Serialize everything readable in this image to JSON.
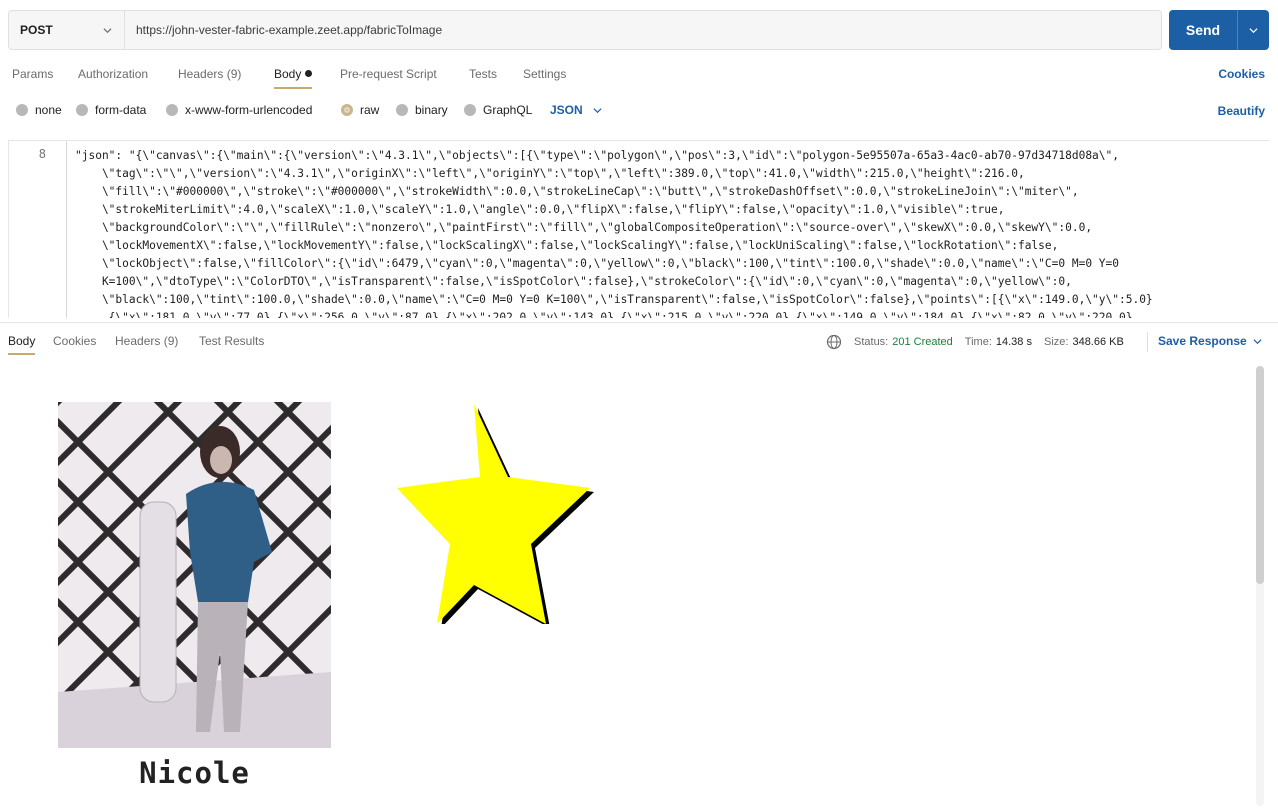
{
  "request": {
    "method": "POST",
    "url": "https://john-vester-fabric-example.zeet.app/fabricToImage",
    "send_label": "Send"
  },
  "request_tabs": [
    {
      "label": "Params"
    },
    {
      "label": "Authorization"
    },
    {
      "label": "Headers",
      "count": "(9)"
    },
    {
      "label": "Body"
    },
    {
      "label": "Pre-request Script"
    },
    {
      "label": "Tests"
    },
    {
      "label": "Settings"
    }
  ],
  "cookies_label": "Cookies",
  "body_types": [
    {
      "label": "none"
    },
    {
      "label": "form-data"
    },
    {
      "label": "x-www-form-urlencoded"
    },
    {
      "label": "raw"
    },
    {
      "label": "binary"
    },
    {
      "label": "GraphQL"
    }
  ],
  "body_format": "JSON",
  "beautify_label": "Beautify",
  "editor": {
    "line_number": "8",
    "lines": [
      "\"json\": \"{\\\"canvas\\\":{\\\"main\\\":{\\\"version\\\":\\\"4.3.1\\\",\\\"objects\\\":[{\\\"type\\\":\\\"polygon\\\",\\\"pos\\\":3,\\\"id\\\":\\\"polygon-5e95507a-65a3-4ac0-ab70-97d34718d08a\\\",",
      "    \\\"tag\\\":\\\"\\\",\\\"version\\\":\\\"4.3.1\\\",\\\"originX\\\":\\\"left\\\",\\\"originY\\\":\\\"top\\\",\\\"left\\\":389.0,\\\"top\\\":41.0,\\\"width\\\":215.0,\\\"height\\\":216.0,",
      "    \\\"fill\\\":\\\"#000000\\\",\\\"stroke\\\":\\\"#000000\\\",\\\"strokeWidth\\\":0.0,\\\"strokeLineCap\\\":\\\"butt\\\",\\\"strokeDashOffset\\\":0.0,\\\"strokeLineJoin\\\":\\\"miter\\\",",
      "    \\\"strokeMiterLimit\\\":4.0,\\\"scaleX\\\":1.0,\\\"scaleY\\\":1.0,\\\"angle\\\":0.0,\\\"flipX\\\":false,\\\"flipY\\\":false,\\\"opacity\\\":1.0,\\\"visible\\\":true,",
      "    \\\"backgroundColor\\\":\\\"\\\",\\\"fillRule\\\":\\\"nonzero\\\",\\\"paintFirst\\\":\\\"fill\\\",\\\"globalCompositeOperation\\\":\\\"source-over\\\",\\\"skewX\\\":0.0,\\\"skewY\\\":0.0,",
      "    \\\"lockMovementX\\\":false,\\\"lockMovementY\\\":false,\\\"lockScalingX\\\":false,\\\"lockScalingY\\\":false,\\\"lockUniScaling\\\":false,\\\"lockRotation\\\":false,",
      "    \\\"lockObject\\\":false,\\\"fillColor\\\":{\\\"id\\\":6479,\\\"cyan\\\":0,\\\"magenta\\\":0,\\\"yellow\\\":0,\\\"black\\\":100,\\\"tint\\\":100.0,\\\"shade\\\":0.0,\\\"name\\\":\\\"C=0 M=0 Y=0",
      "    K=100\\\",\\\"dtoType\\\":\\\"ColorDTO\\\",\\\"isTransparent\\\":false,\\\"isSpotColor\\\":false},\\\"strokeColor\\\":{\\\"id\\\":0,\\\"cyan\\\":0,\\\"magenta\\\":0,\\\"yellow\\\":0,",
      "    \\\"black\\\":100,\\\"tint\\\":100.0,\\\"shade\\\":0.0,\\\"name\\\":\\\"C=0 M=0 Y=0 K=100\\\",\\\"isTransparent\\\":false,\\\"isSpotColor\\\":false},\\\"points\\\":[{\\\"x\\\":149.0,\\\"y\\\":5.0}",
      "    ,{\\\"x\\\":181.0,\\\"y\\\":77.0},{\\\"x\\\":256.0,\\\"y\\\":87.0},{\\\"x\\\":202.0,\\\"y\\\":143.0},{\\\"x\\\":215.0,\\\"y\\\":220.0},{\\\"x\\\":149.0,\\\"y\\\":184.0},{\\\"x\\\":82.0,\\\"y\\\":220.0}"
    ]
  },
  "response_tabs": [
    {
      "label": "Body"
    },
    {
      "label": "Cookies"
    },
    {
      "label": "Headers",
      "count": "(9)"
    },
    {
      "label": "Test Results"
    }
  ],
  "response_meta": {
    "status_label": "Status:",
    "status_value": "201 Created",
    "time_label": "Time:",
    "time_value": "14.38 s",
    "size_label": "Size:",
    "size_value": "348.66 KB"
  },
  "save_response_label": "Save Response",
  "preview": {
    "caption": "Nicole"
  },
  "colors": {
    "accent": "#1d5fa5",
    "star_fill": "#ffff00",
    "star_shadow": "#000000",
    "status_ok": "#1e7f3a"
  }
}
